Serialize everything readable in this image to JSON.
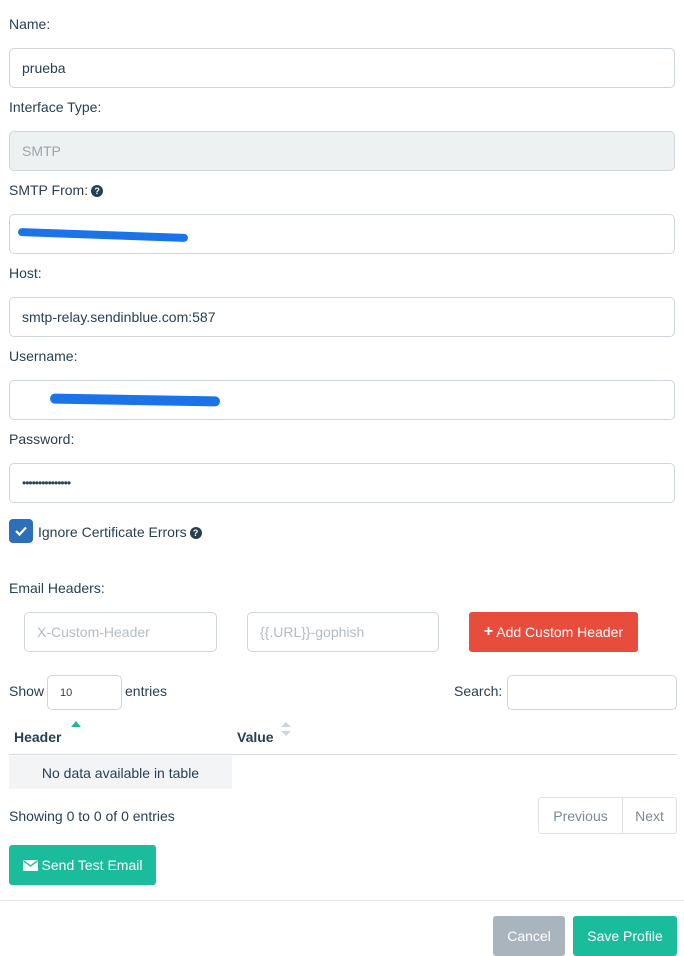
{
  "form": {
    "name_label": "Name:",
    "name_value": "prueba",
    "interface_label": "Interface Type:",
    "interface_value": "SMTP",
    "from_label": "SMTP From:",
    "host_label": "Host:",
    "host_value": "smtp-relay.sendinblue.com:587",
    "username_label": "Username:",
    "password_label": "Password:",
    "password_value": "•••••••••••••••",
    "ignore_label": "Ignore Certificate Errors",
    "ignore_checked": true
  },
  "headers": {
    "label": "Email Headers:",
    "key_placeholder": "X-Custom-Header",
    "value_placeholder": "{{.URL}}-gophish",
    "add_button": "Add Custom Header"
  },
  "table": {
    "show_label": "Show",
    "entries_value": "10",
    "entries_label": "entries",
    "search_label": "Search:",
    "col_header": "Header",
    "col_value": "Value",
    "empty_text": "No data available in table",
    "info_text": "Showing 0 to 0 of 0 entries",
    "prev": "Previous",
    "next": "Next"
  },
  "actions": {
    "send_test": "Send Test Email",
    "cancel": "Cancel",
    "save": "Save Profile"
  },
  "colors": {
    "accent": "#1abc9c",
    "danger": "#e74c3c",
    "checkbox": "#2c6fbb"
  }
}
